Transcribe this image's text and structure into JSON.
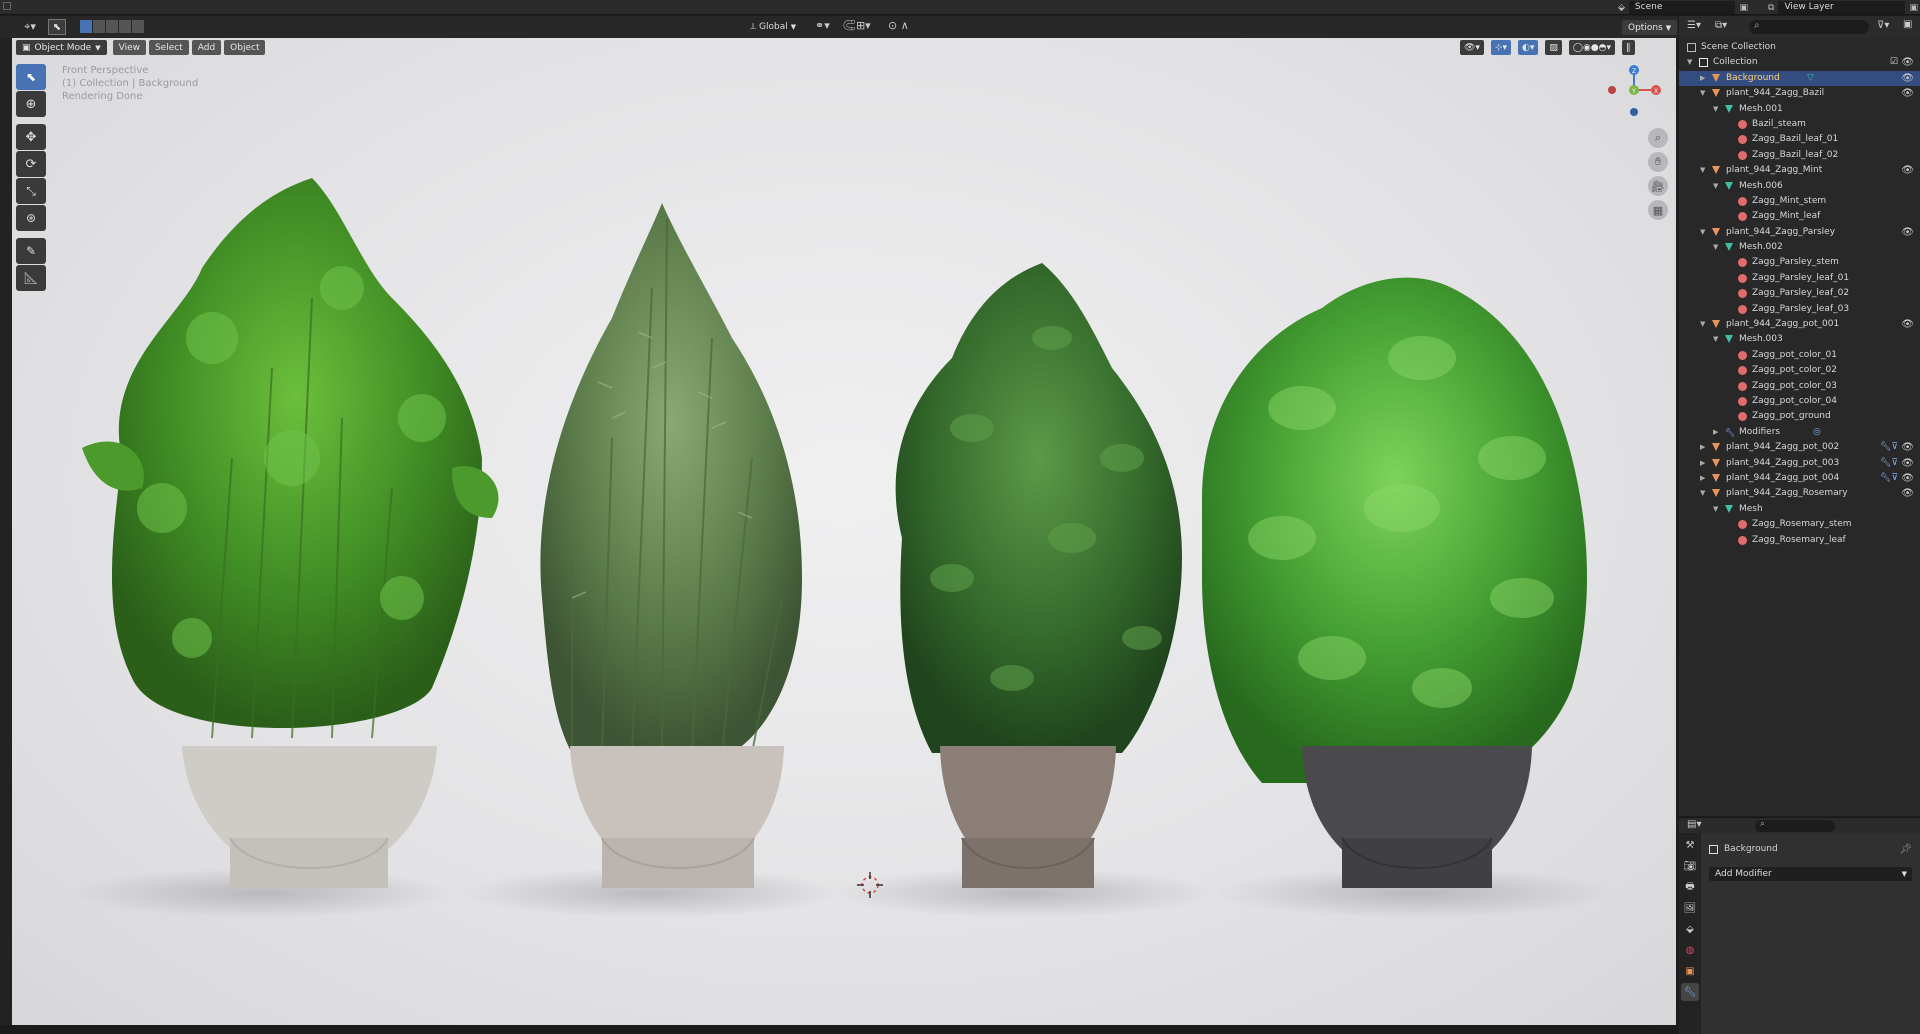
{
  "topbar": {
    "scene_label": "Scene",
    "view_layer_label": "View Layer"
  },
  "viewport_header": {
    "transform_orientation": "Global",
    "options_label": "Options"
  },
  "viewport_menu": {
    "mode": "Object Mode",
    "menus": [
      "View",
      "Select",
      "Add",
      "Object"
    ]
  },
  "viewport_overlay": {
    "line1": "Front Perspective",
    "line2": "(1) Collection | Background",
    "line3": "Rendering Done"
  },
  "gizmo": {
    "x_label": "X",
    "y_label": "Y",
    "z_label": "Z"
  },
  "toolbar_tools": [
    "select-box",
    "cursor",
    "move",
    "rotate",
    "scale",
    "transform",
    "annotate",
    "measure"
  ],
  "outliner": {
    "root": "Scene Collection",
    "rows": [
      {
        "label": "Collection",
        "depth": 1,
        "type": "collection",
        "expanded": true,
        "check": true,
        "eye": true
      },
      {
        "label": "Background",
        "depth": 2,
        "type": "object",
        "expanded": false,
        "selected": true,
        "eye": true
      },
      {
        "label": "plant_944_Zagg_Bazil",
        "depth": 2,
        "type": "object",
        "expanded": true,
        "eye": true
      },
      {
        "label": "Mesh.001",
        "depth": 3,
        "type": "mesh",
        "expanded": true
      },
      {
        "label": "Bazil_steam",
        "depth": 4,
        "type": "material"
      },
      {
        "label": "Zagg_Bazil_leaf_01",
        "depth": 4,
        "type": "material"
      },
      {
        "label": "Zagg_Bazil_leaf_02",
        "depth": 4,
        "type": "material"
      },
      {
        "label": "plant_944_Zagg_Mint",
        "depth": 2,
        "type": "object",
        "expanded": true,
        "eye": true
      },
      {
        "label": "Mesh.006",
        "depth": 3,
        "type": "mesh",
        "expanded": true
      },
      {
        "label": "Zagg_Mint_stem",
        "depth": 4,
        "type": "material"
      },
      {
        "label": "Zagg_Mint_leaf",
        "depth": 4,
        "type": "material"
      },
      {
        "label": "plant_944_Zagg_Parsley",
        "depth": 2,
        "type": "object",
        "expanded": true,
        "eye": true
      },
      {
        "label": "Mesh.002",
        "depth": 3,
        "type": "mesh",
        "expanded": true
      },
      {
        "label": "Zagg_Parsley_stem",
        "depth": 4,
        "type": "material"
      },
      {
        "label": "Zagg_Parsley_leaf_01",
        "depth": 4,
        "type": "material"
      },
      {
        "label": "Zagg_Parsley_leaf_02",
        "depth": 4,
        "type": "material"
      },
      {
        "label": "Zagg_Parsley_leaf_03",
        "depth": 4,
        "type": "material"
      },
      {
        "label": "plant_944_Zagg_pot_001",
        "depth": 2,
        "type": "object",
        "expanded": true,
        "eye": true
      },
      {
        "label": "Mesh.003",
        "depth": 3,
        "type": "mesh",
        "expanded": true
      },
      {
        "label": "Zagg_pot_color_01",
        "depth": 4,
        "type": "material"
      },
      {
        "label": "Zagg_pot_color_02",
        "depth": 4,
        "type": "material"
      },
      {
        "label": "Zagg_pot_color_03",
        "depth": 4,
        "type": "material"
      },
      {
        "label": "Zagg_pot_color_04",
        "depth": 4,
        "type": "material"
      },
      {
        "label": "Zagg_pot_ground",
        "depth": 4,
        "type": "material"
      },
      {
        "label": "Modifiers",
        "depth": 3,
        "type": "modifier",
        "expanded": false
      },
      {
        "label": "plant_944_Zagg_pot_002",
        "depth": 2,
        "type": "object",
        "expanded": false,
        "eye": true,
        "extras": true
      },
      {
        "label": "plant_944_Zagg_pot_003",
        "depth": 2,
        "type": "object",
        "expanded": false,
        "eye": true,
        "extras": true
      },
      {
        "label": "plant_944_Zagg_pot_004",
        "depth": 2,
        "type": "object",
        "expanded": false,
        "eye": true,
        "extras": true
      },
      {
        "label": "plant_944_Zagg_Rosemary",
        "depth": 2,
        "type": "object",
        "expanded": true,
        "eye": true
      },
      {
        "label": "Mesh",
        "depth": 3,
        "type": "mesh",
        "expanded": true
      },
      {
        "label": "Zagg_Rosemary_stem",
        "depth": 4,
        "type": "material"
      },
      {
        "label": "Zagg_Rosemary_leaf",
        "depth": 4,
        "type": "material"
      }
    ]
  },
  "properties": {
    "object_name": "Background",
    "add_modifier_label": "Add Modifier"
  },
  "colors": {
    "accent": "#4772b3",
    "selected_row": "#334d80",
    "object_icon": "#e8945a",
    "mesh_icon": "#3fbfa6",
    "material_icon": "#e26b6b",
    "axis_x": "#d9534f",
    "axis_y": "#7ab648",
    "axis_z": "#3a7bd5"
  }
}
